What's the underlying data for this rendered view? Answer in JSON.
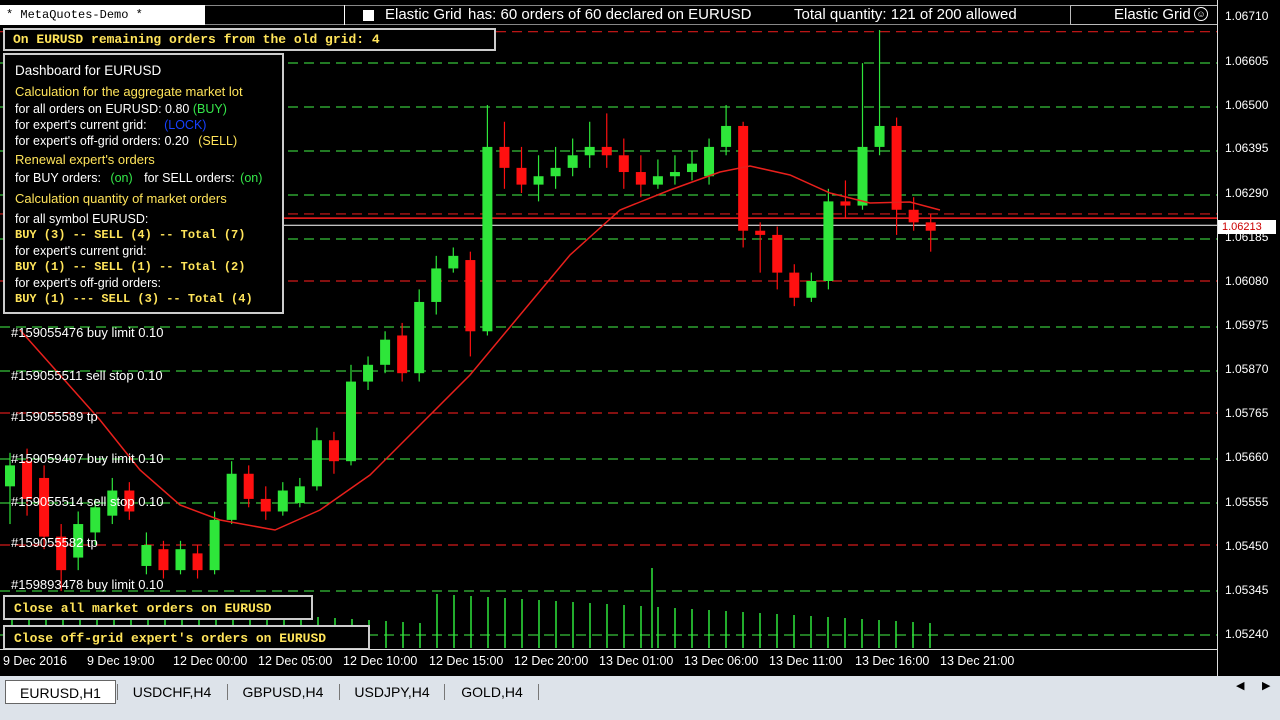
{
  "window": {
    "title": "*  MetaQuotes-Demo  *",
    "grid_title": "Elastic Grid",
    "orders_status": "has: 60 orders of 60 declared on EURUSD",
    "quantity_status": "Total quantity: 121 of 200 allowed",
    "ea_name": "Elastic Grid",
    "smile_icon": "smile-icon"
  },
  "old_grid": {
    "text": "On EURUSD remaining orders from the old grid: 4"
  },
  "dashboard": {
    "title": "Dashboard for EURUSD",
    "calc_lot_heading": "Calculation for the aggregate market lot",
    "all_orders_label": "for all orders on EURUSD: 0.80",
    "all_orders_dir": "(BUY)",
    "current_grid_label": "for expert's current grid:",
    "current_grid_val": "(LOCK)",
    "offgrid_label": "for expert's off-grid orders: 0.20",
    "offgrid_dir": "(SELL)",
    "renewal_heading": "Renewal  expert's  orders",
    "buy_orders_label": "for BUY orders:",
    "buy_orders_val": "(on)",
    "sell_orders_label": "for SELL orders:",
    "sell_orders_val": "(on)",
    "calc_qty_heading": "Calculation quantity of market orders",
    "all_symbol_label": "for all symbol EURUSD:",
    "all_symbol_counts": "BUY (3) -- SELL (4) -- Total (7)",
    "current_grid_label2": "for expert's current grid:",
    "current_grid_counts": "BUY (1) -- SELL (1) -- Total (2)",
    "offgrid_label2": "for expert's off-grid orders:",
    "offgrid_counts": "BUY (1) --- SELL (3) -- Total (4)"
  },
  "order_labels": [
    "#159055476 buy limit 0.10",
    "#159055511 sell stop 0.10",
    "#159055589 tp",
    "#159059407 buy limit 0.10",
    "#159055514 sell stop 0.10",
    "#159055582 tp",
    "#159893478 buy limit 0.10"
  ],
  "buttons": {
    "close_all": "Close all market orders on EURUSD",
    "close_offgrid": "Close off-grid expert's orders on EURUSD"
  },
  "y_axis": [
    "1.06710",
    "1.06605",
    "1.06500",
    "1.06395",
    "1.06290",
    "1.06185",
    "1.06080",
    "1.05975",
    "1.05870",
    "1.05765",
    "1.05660",
    "1.05555",
    "1.05450",
    "1.05345",
    "1.05240"
  ],
  "current_price": "1.06213",
  "x_axis": [
    "9 Dec 2016",
    "9 Dec 19:00",
    "12 Dec 00:00",
    "12 Dec 05:00",
    "12 Dec 10:00",
    "12 Dec 15:00",
    "12 Dec 20:00",
    "13 Dec 01:00",
    "13 Dec 06:00",
    "13 Dec 11:00",
    "13 Dec 16:00",
    "13 Dec 21:00"
  ],
  "tabs": [
    "EURUSD,H1",
    "USDCHF,H4",
    "GBPUSD,H4",
    "USDJPY,H4",
    "GOLD,H4"
  ],
  "nav_icons": {
    "left": "nav-left-icon",
    "right": "nav-right-icon"
  },
  "colors": {
    "bull": "#2ee63a",
    "bear": "#ff1010",
    "ma": "#e8201c",
    "grid_green": "#37c43a",
    "grid_red": "#d41a1a",
    "volume": "#2ee63a"
  }
}
